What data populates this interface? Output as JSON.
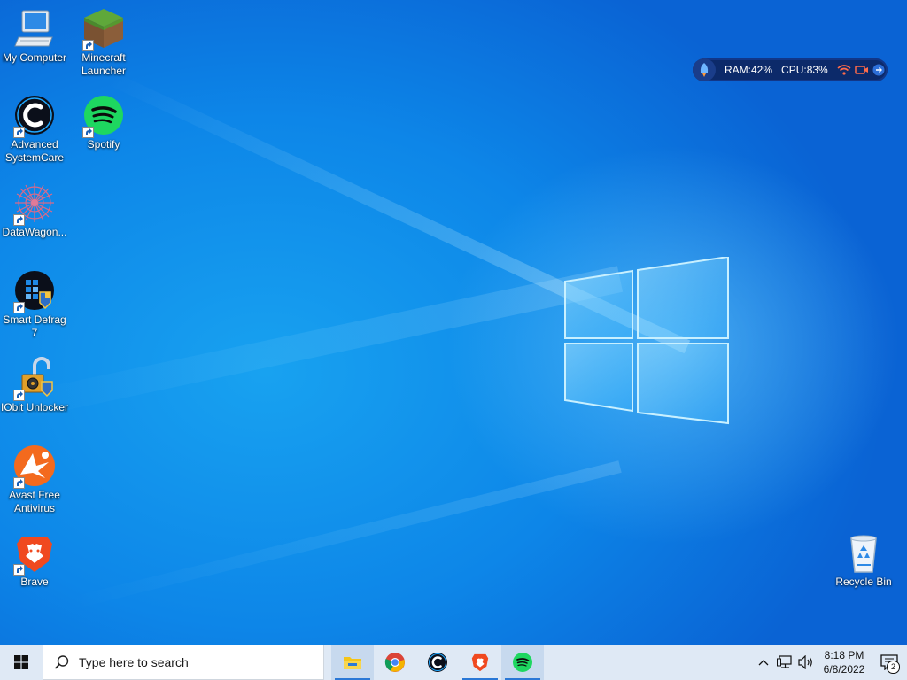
{
  "desktop": {
    "icons": [
      {
        "label": "My Computer",
        "icon": "computer-icon"
      },
      {
        "label": "Minecraft Launcher",
        "icon": "minecraft-icon"
      },
      {
        "label": "Advanced SystemCare",
        "icon": "advanced-systemcare-icon"
      },
      {
        "label": "Spotify",
        "icon": "spotify-icon"
      },
      {
        "label": "DataWagon...",
        "icon": "datawagon-icon"
      },
      {
        "label": "Smart Defrag 7",
        "icon": "smart-defrag-icon"
      },
      {
        "label": "IObit Unlocker",
        "icon": "iobit-unlocker-icon"
      },
      {
        "label": "Avast Free Antivirus",
        "icon": "avast-icon"
      },
      {
        "label": "Brave",
        "icon": "brave-icon"
      },
      {
        "label": "Recycle Bin",
        "icon": "recycle-bin-icon"
      }
    ]
  },
  "widget": {
    "ram": "RAM:42%",
    "cpu": "CPU:83%",
    "accent": "#0c2a6a"
  },
  "taskbar": {
    "search_placeholder": "Type here to search",
    "apps": [
      {
        "name": "File Explorer",
        "icon": "folder-icon",
        "running": true
      },
      {
        "name": "Google Chrome",
        "icon": "chrome-icon",
        "running": false
      },
      {
        "name": "Advanced SystemCare",
        "icon": "advanced-systemcare-icon",
        "running": false
      },
      {
        "name": "Brave",
        "icon": "brave-icon",
        "running": true
      },
      {
        "name": "Spotify",
        "icon": "spotify-icon",
        "running": true
      }
    ],
    "clock": {
      "time": "8:18 PM",
      "date": "6/8/2022"
    },
    "notification_count": "2",
    "background": "#dfe9f5"
  }
}
